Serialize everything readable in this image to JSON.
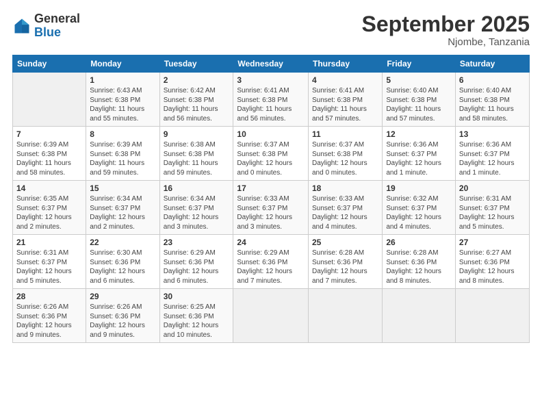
{
  "logo": {
    "general": "General",
    "blue": "Blue"
  },
  "header": {
    "month": "September 2025",
    "location": "Njombe, Tanzania"
  },
  "days_of_week": [
    "Sunday",
    "Monday",
    "Tuesday",
    "Wednesday",
    "Thursday",
    "Friday",
    "Saturday"
  ],
  "weeks": [
    [
      {
        "day": "",
        "info": ""
      },
      {
        "day": "1",
        "info": "Sunrise: 6:43 AM\nSunset: 6:38 PM\nDaylight: 11 hours\nand 55 minutes."
      },
      {
        "day": "2",
        "info": "Sunrise: 6:42 AM\nSunset: 6:38 PM\nDaylight: 11 hours\nand 56 minutes."
      },
      {
        "day": "3",
        "info": "Sunrise: 6:41 AM\nSunset: 6:38 PM\nDaylight: 11 hours\nand 56 minutes."
      },
      {
        "day": "4",
        "info": "Sunrise: 6:41 AM\nSunset: 6:38 PM\nDaylight: 11 hours\nand 57 minutes."
      },
      {
        "day": "5",
        "info": "Sunrise: 6:40 AM\nSunset: 6:38 PM\nDaylight: 11 hours\nand 57 minutes."
      },
      {
        "day": "6",
        "info": "Sunrise: 6:40 AM\nSunset: 6:38 PM\nDaylight: 11 hours\nand 58 minutes."
      }
    ],
    [
      {
        "day": "7",
        "info": "Sunrise: 6:39 AM\nSunset: 6:38 PM\nDaylight: 11 hours\nand 58 minutes."
      },
      {
        "day": "8",
        "info": "Sunrise: 6:39 AM\nSunset: 6:38 PM\nDaylight: 11 hours\nand 59 minutes."
      },
      {
        "day": "9",
        "info": "Sunrise: 6:38 AM\nSunset: 6:38 PM\nDaylight: 11 hours\nand 59 minutes."
      },
      {
        "day": "10",
        "info": "Sunrise: 6:37 AM\nSunset: 6:38 PM\nDaylight: 12 hours\nand 0 minutes."
      },
      {
        "day": "11",
        "info": "Sunrise: 6:37 AM\nSunset: 6:38 PM\nDaylight: 12 hours\nand 0 minutes."
      },
      {
        "day": "12",
        "info": "Sunrise: 6:36 AM\nSunset: 6:37 PM\nDaylight: 12 hours\nand 1 minute."
      },
      {
        "day": "13",
        "info": "Sunrise: 6:36 AM\nSunset: 6:37 PM\nDaylight: 12 hours\nand 1 minute."
      }
    ],
    [
      {
        "day": "14",
        "info": "Sunrise: 6:35 AM\nSunset: 6:37 PM\nDaylight: 12 hours\nand 2 minutes."
      },
      {
        "day": "15",
        "info": "Sunrise: 6:34 AM\nSunset: 6:37 PM\nDaylight: 12 hours\nand 2 minutes."
      },
      {
        "day": "16",
        "info": "Sunrise: 6:34 AM\nSunset: 6:37 PM\nDaylight: 12 hours\nand 3 minutes."
      },
      {
        "day": "17",
        "info": "Sunrise: 6:33 AM\nSunset: 6:37 PM\nDaylight: 12 hours\nand 3 minutes."
      },
      {
        "day": "18",
        "info": "Sunrise: 6:33 AM\nSunset: 6:37 PM\nDaylight: 12 hours\nand 4 minutes."
      },
      {
        "day": "19",
        "info": "Sunrise: 6:32 AM\nSunset: 6:37 PM\nDaylight: 12 hours\nand 4 minutes."
      },
      {
        "day": "20",
        "info": "Sunrise: 6:31 AM\nSunset: 6:37 PM\nDaylight: 12 hours\nand 5 minutes."
      }
    ],
    [
      {
        "day": "21",
        "info": "Sunrise: 6:31 AM\nSunset: 6:37 PM\nDaylight: 12 hours\nand 5 minutes."
      },
      {
        "day": "22",
        "info": "Sunrise: 6:30 AM\nSunset: 6:36 PM\nDaylight: 12 hours\nand 6 minutes."
      },
      {
        "day": "23",
        "info": "Sunrise: 6:29 AM\nSunset: 6:36 PM\nDaylight: 12 hours\nand 6 minutes."
      },
      {
        "day": "24",
        "info": "Sunrise: 6:29 AM\nSunset: 6:36 PM\nDaylight: 12 hours\nand 7 minutes."
      },
      {
        "day": "25",
        "info": "Sunrise: 6:28 AM\nSunset: 6:36 PM\nDaylight: 12 hours\nand 7 minutes."
      },
      {
        "day": "26",
        "info": "Sunrise: 6:28 AM\nSunset: 6:36 PM\nDaylight: 12 hours\nand 8 minutes."
      },
      {
        "day": "27",
        "info": "Sunrise: 6:27 AM\nSunset: 6:36 PM\nDaylight: 12 hours\nand 8 minutes."
      }
    ],
    [
      {
        "day": "28",
        "info": "Sunrise: 6:26 AM\nSunset: 6:36 PM\nDaylight: 12 hours\nand 9 minutes."
      },
      {
        "day": "29",
        "info": "Sunrise: 6:26 AM\nSunset: 6:36 PM\nDaylight: 12 hours\nand 9 minutes."
      },
      {
        "day": "30",
        "info": "Sunrise: 6:25 AM\nSunset: 6:36 PM\nDaylight: 12 hours\nand 10 minutes."
      },
      {
        "day": "",
        "info": ""
      },
      {
        "day": "",
        "info": ""
      },
      {
        "day": "",
        "info": ""
      },
      {
        "day": "",
        "info": ""
      }
    ]
  ]
}
